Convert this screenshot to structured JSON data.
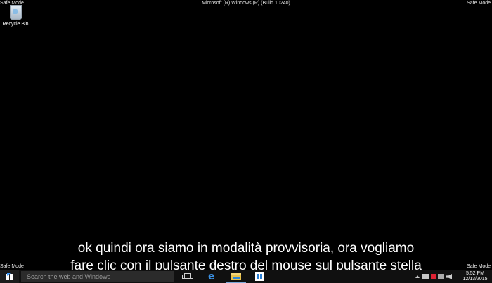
{
  "window": {
    "title": "Microsoft (R) Windows (R) (Build 10240)",
    "mode_label": "Safe Mode"
  },
  "desktop": {
    "icons": [
      {
        "label": "Recycle Bin",
        "icon": "recycle-bin-icon"
      }
    ]
  },
  "subtitles": [
    "ok quindi ora siamo in modalità provvisoria, ora vogliamo",
    "fare clic con il pulsante destro del mouse sul pulsante stella"
  ],
  "taskbar": {
    "search_placeholder": "Search the web and Windows",
    "pinned": [
      "task-view-icon",
      "edge-icon",
      "file-explorer-icon",
      "store-icon"
    ],
    "clock": {
      "time": "5:52 PM",
      "date": "12/13/2015"
    }
  }
}
